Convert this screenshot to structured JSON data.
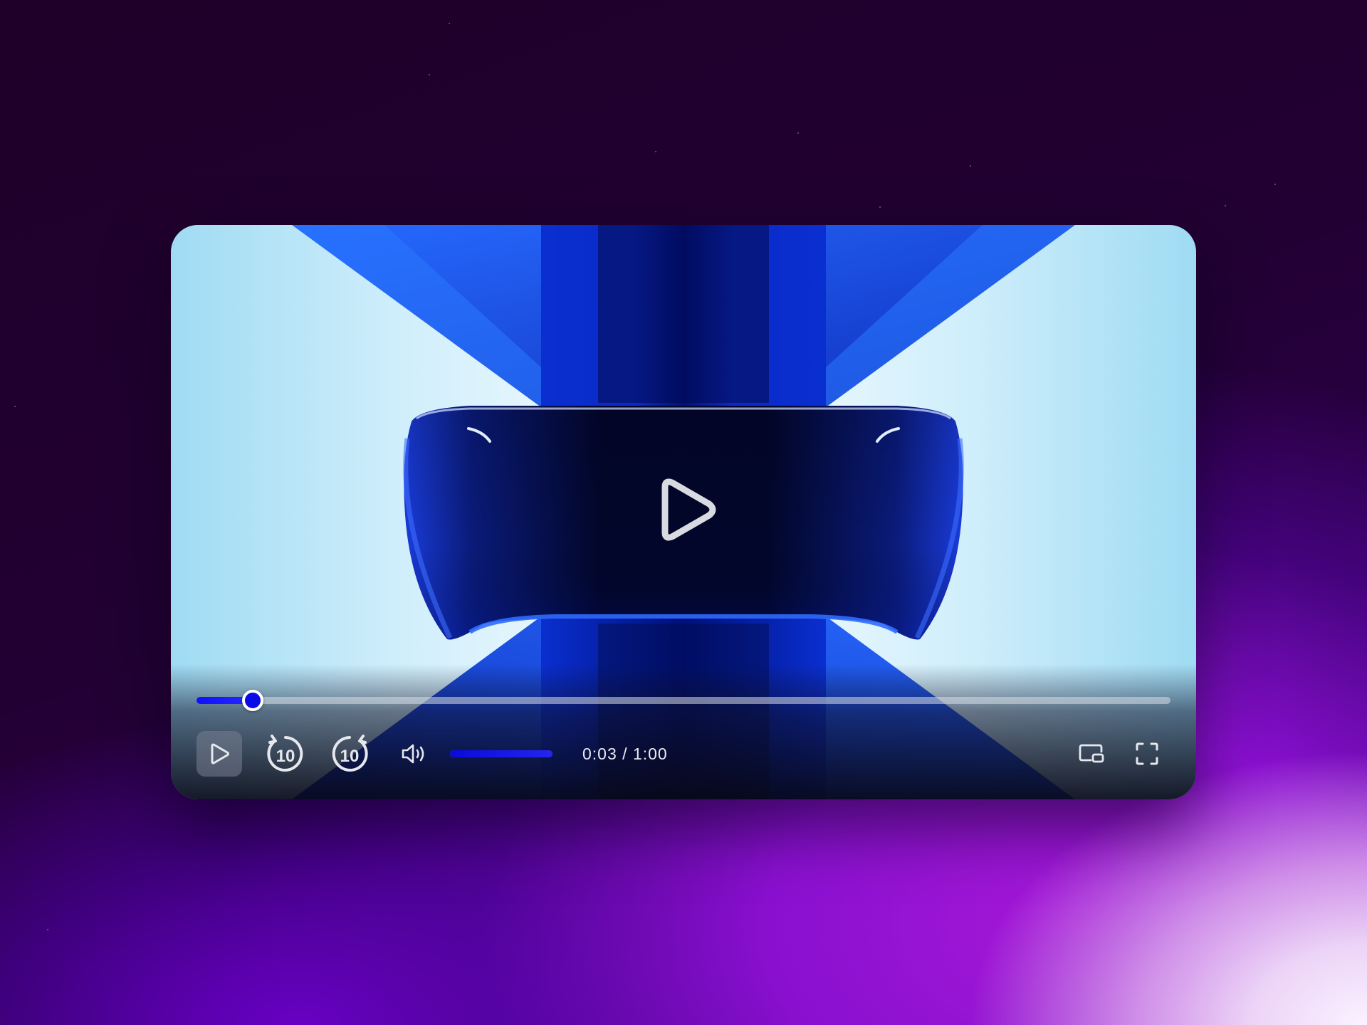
{
  "player": {
    "current_time": "0:03",
    "separator": " / ",
    "duration": "1:00",
    "progress_fraction": 0.058,
    "volume_fraction": 1.0,
    "rewind_seconds": "10",
    "forward_seconds": "10"
  },
  "icons": {
    "big_play": "play-icon",
    "play": "play-icon",
    "rewind": "rewind-10-icon",
    "forward": "forward-10-icon",
    "volume": "volume-icon",
    "pip": "picture-in-picture-icon",
    "fullscreen": "fullscreen-icon"
  },
  "colors": {
    "accent": "#0a0ae6",
    "control_icon": "#e6e8ee"
  }
}
